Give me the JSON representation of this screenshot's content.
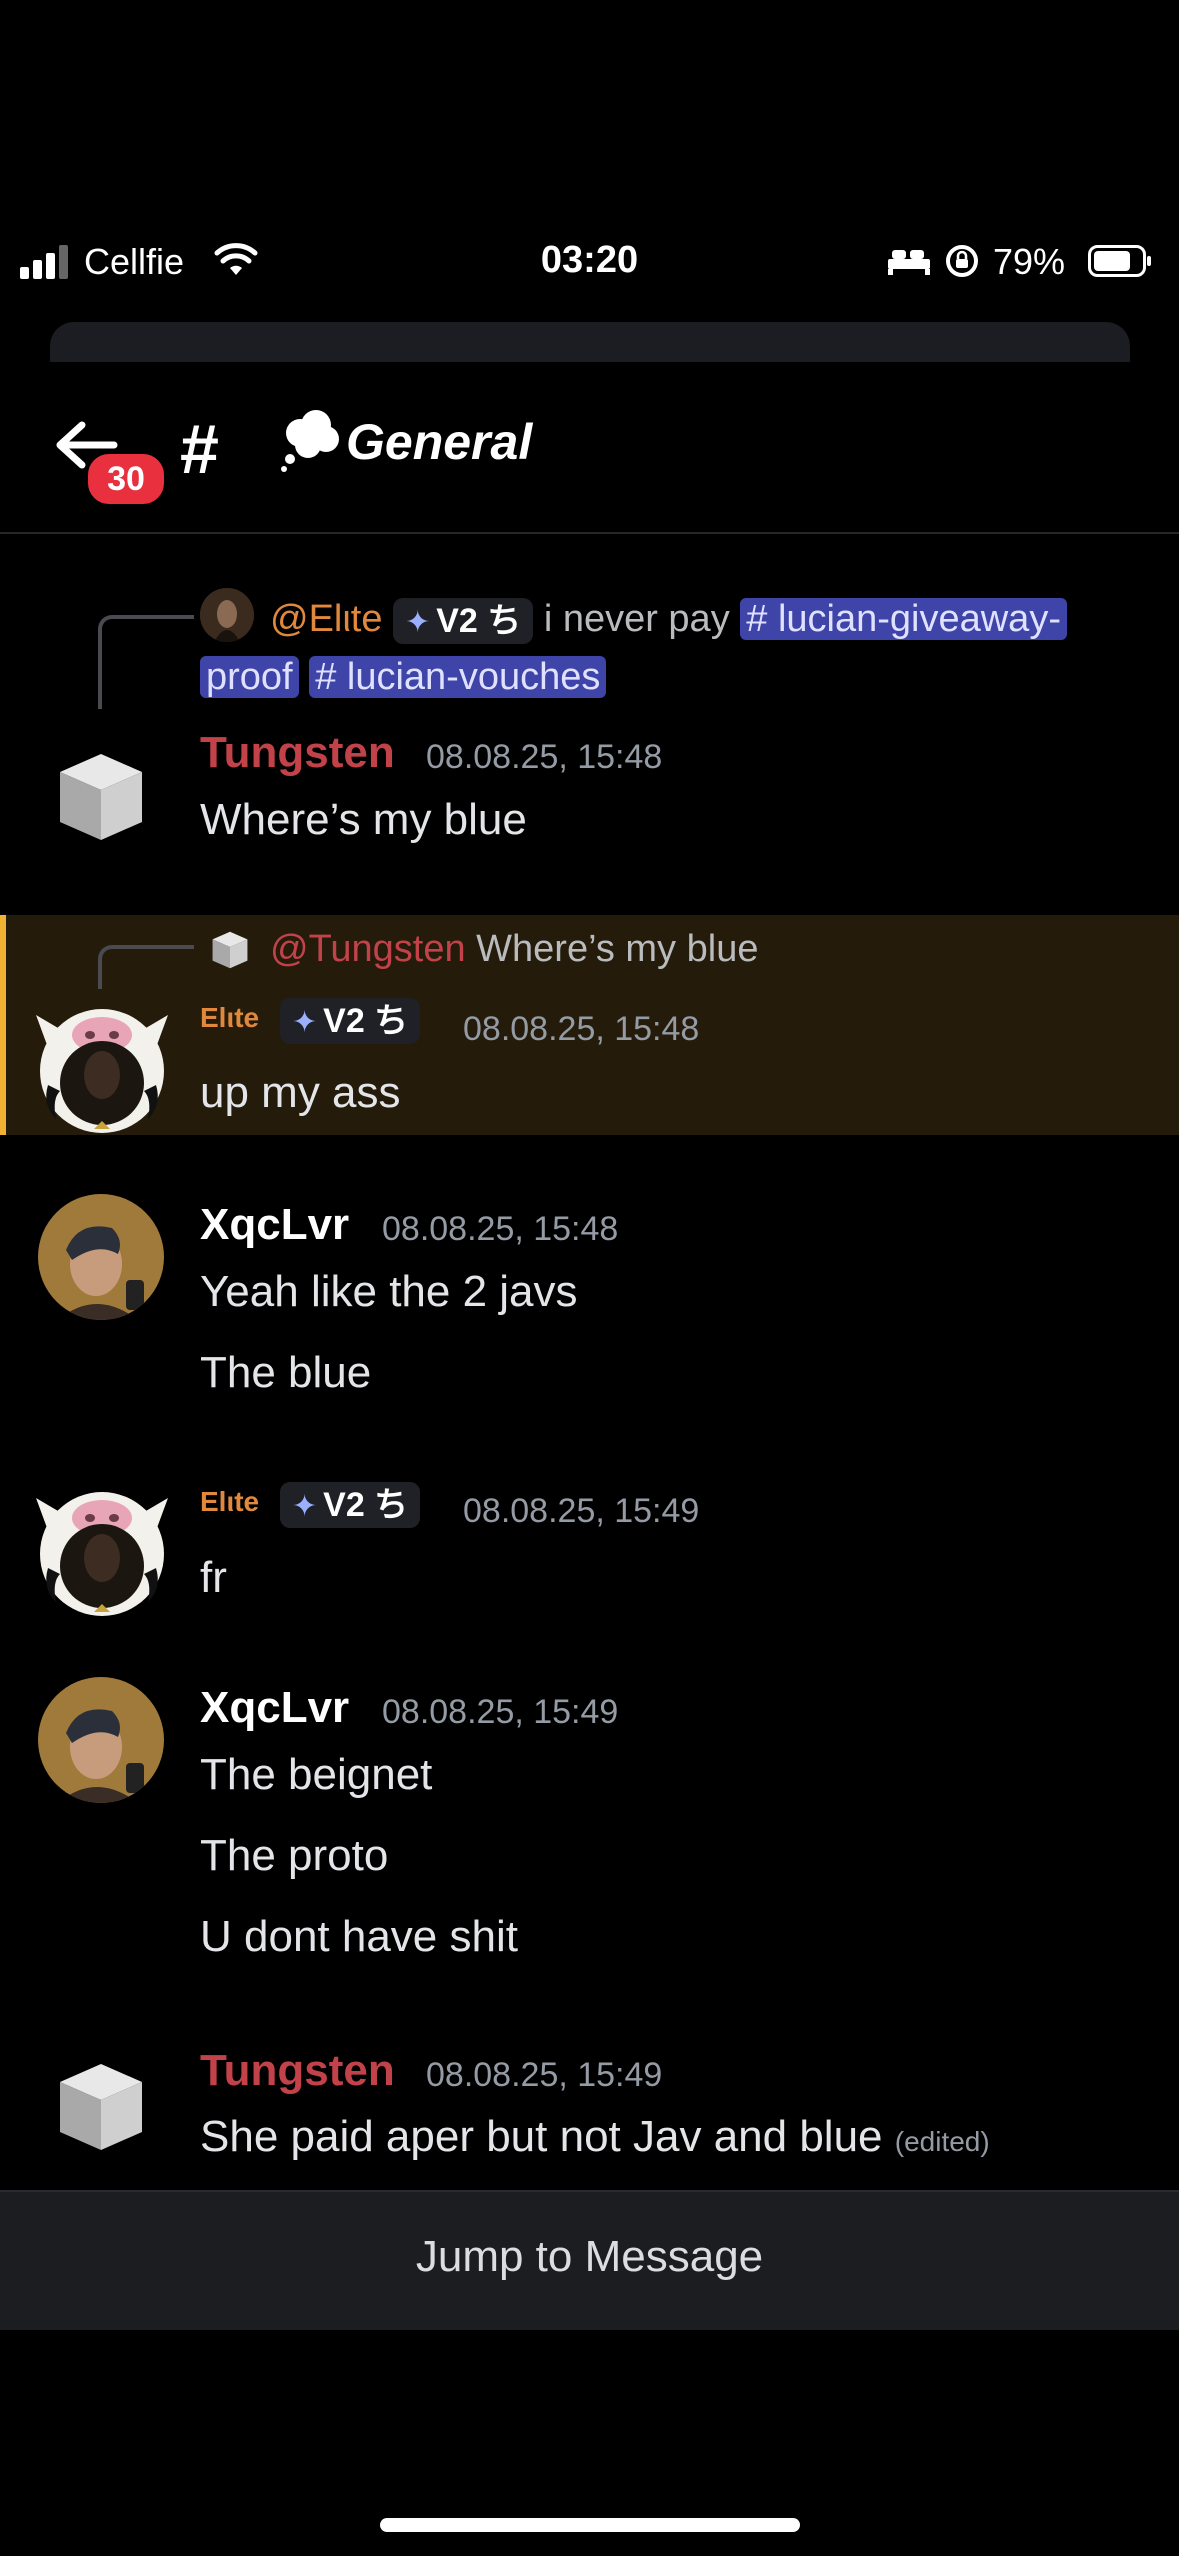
{
  "status_bar": {
    "carrier": "Cellfie",
    "time": "03:20",
    "battery_percent": "79%",
    "battery_level": 0.79
  },
  "header": {
    "unread_badge": "30",
    "channel_name": "General"
  },
  "messages": [
    {
      "reply": {
        "author": "@Elιte",
        "role_tag": "V2 ち",
        "text": "i never pay",
        "channel_link_1": "# lucian-giveaway-",
        "channel_link_1b": "proof",
        "channel_link_2": "# lucian-vouches"
      },
      "author": "Tungsten",
      "timestamp": "08.08.25, 15:48",
      "lines": [
        "Where’s my blue"
      ]
    },
    {
      "reply": {
        "author": "@Tungsten",
        "text": "Where’s my blue"
      },
      "author": "Elιte",
      "role_tag": "V2 ち",
      "timestamp": "08.08.25, 15:48",
      "lines": [
        "up my ass"
      ]
    },
    {
      "author": "XqcLvr",
      "timestamp": "08.08.25, 15:48",
      "lines": [
        "Yeah like the 2 javs",
        "The blue"
      ]
    },
    {
      "author": "Elιte",
      "role_tag": "V2 ち",
      "timestamp": "08.08.25, 15:49",
      "lines": [
        "fr"
      ]
    },
    {
      "author": "XqcLvr",
      "timestamp": "08.08.25, 15:49",
      "lines": [
        "The beignet",
        "The proto",
        "U dont have shit"
      ]
    },
    {
      "author": "Tungsten",
      "timestamp": "08.08.25, 15:49",
      "lines": [
        "She paid aper but not Jav and blue"
      ],
      "edited_label": "(edited)"
    }
  ],
  "jump_bar": {
    "label": "Jump to Message"
  },
  "colors": {
    "tungsten_name": "#c2424a",
    "elite_name": "#e0883d",
    "xqc_name": "#ffffff",
    "highlight_bar": "#f0b232",
    "badge": "#e8303e"
  }
}
